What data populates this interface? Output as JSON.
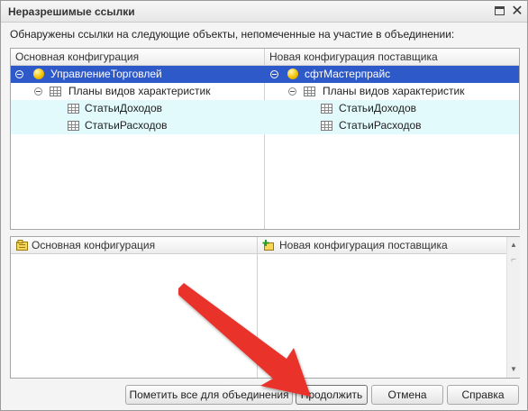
{
  "window": {
    "title": "Неразрешимые ссылки"
  },
  "description": "Обнаружены ссылки на следующие  объекты, непомеченные на участие в объединении:",
  "top_table": {
    "columns": [
      "Основная конфигурация",
      "Новая конфигурация поставщика"
    ],
    "left_rows": [
      "УправлениеТорговлей",
      "Планы видов характеристик",
      "СтатьиДоходов",
      "СтатьиРасходов"
    ],
    "right_rows": [
      "сфтМастерпрайс",
      "Планы видов характеристик",
      "СтатьиДоходов",
      "СтатьиРасходов"
    ]
  },
  "bottom_table": {
    "columns": [
      "Основная конфигурация",
      "Новая конфигурация поставщика"
    ]
  },
  "buttons": {
    "mark_all": "Пометить все для объединения",
    "continue": "Продолжить",
    "cancel": "Отмена",
    "help": "Справка"
  },
  "colors": {
    "selection": "#2e59c9",
    "alt_row": "#e3fafc",
    "annotation_arrow": "#e8312a"
  },
  "icons": [
    "maximize-icon",
    "close-icon",
    "collapse-icon",
    "configuration-icon",
    "characteristic-types-icon",
    "catalog-icon",
    "scroll-up-icon",
    "scroll-down-icon",
    "add-config-icon"
  ]
}
